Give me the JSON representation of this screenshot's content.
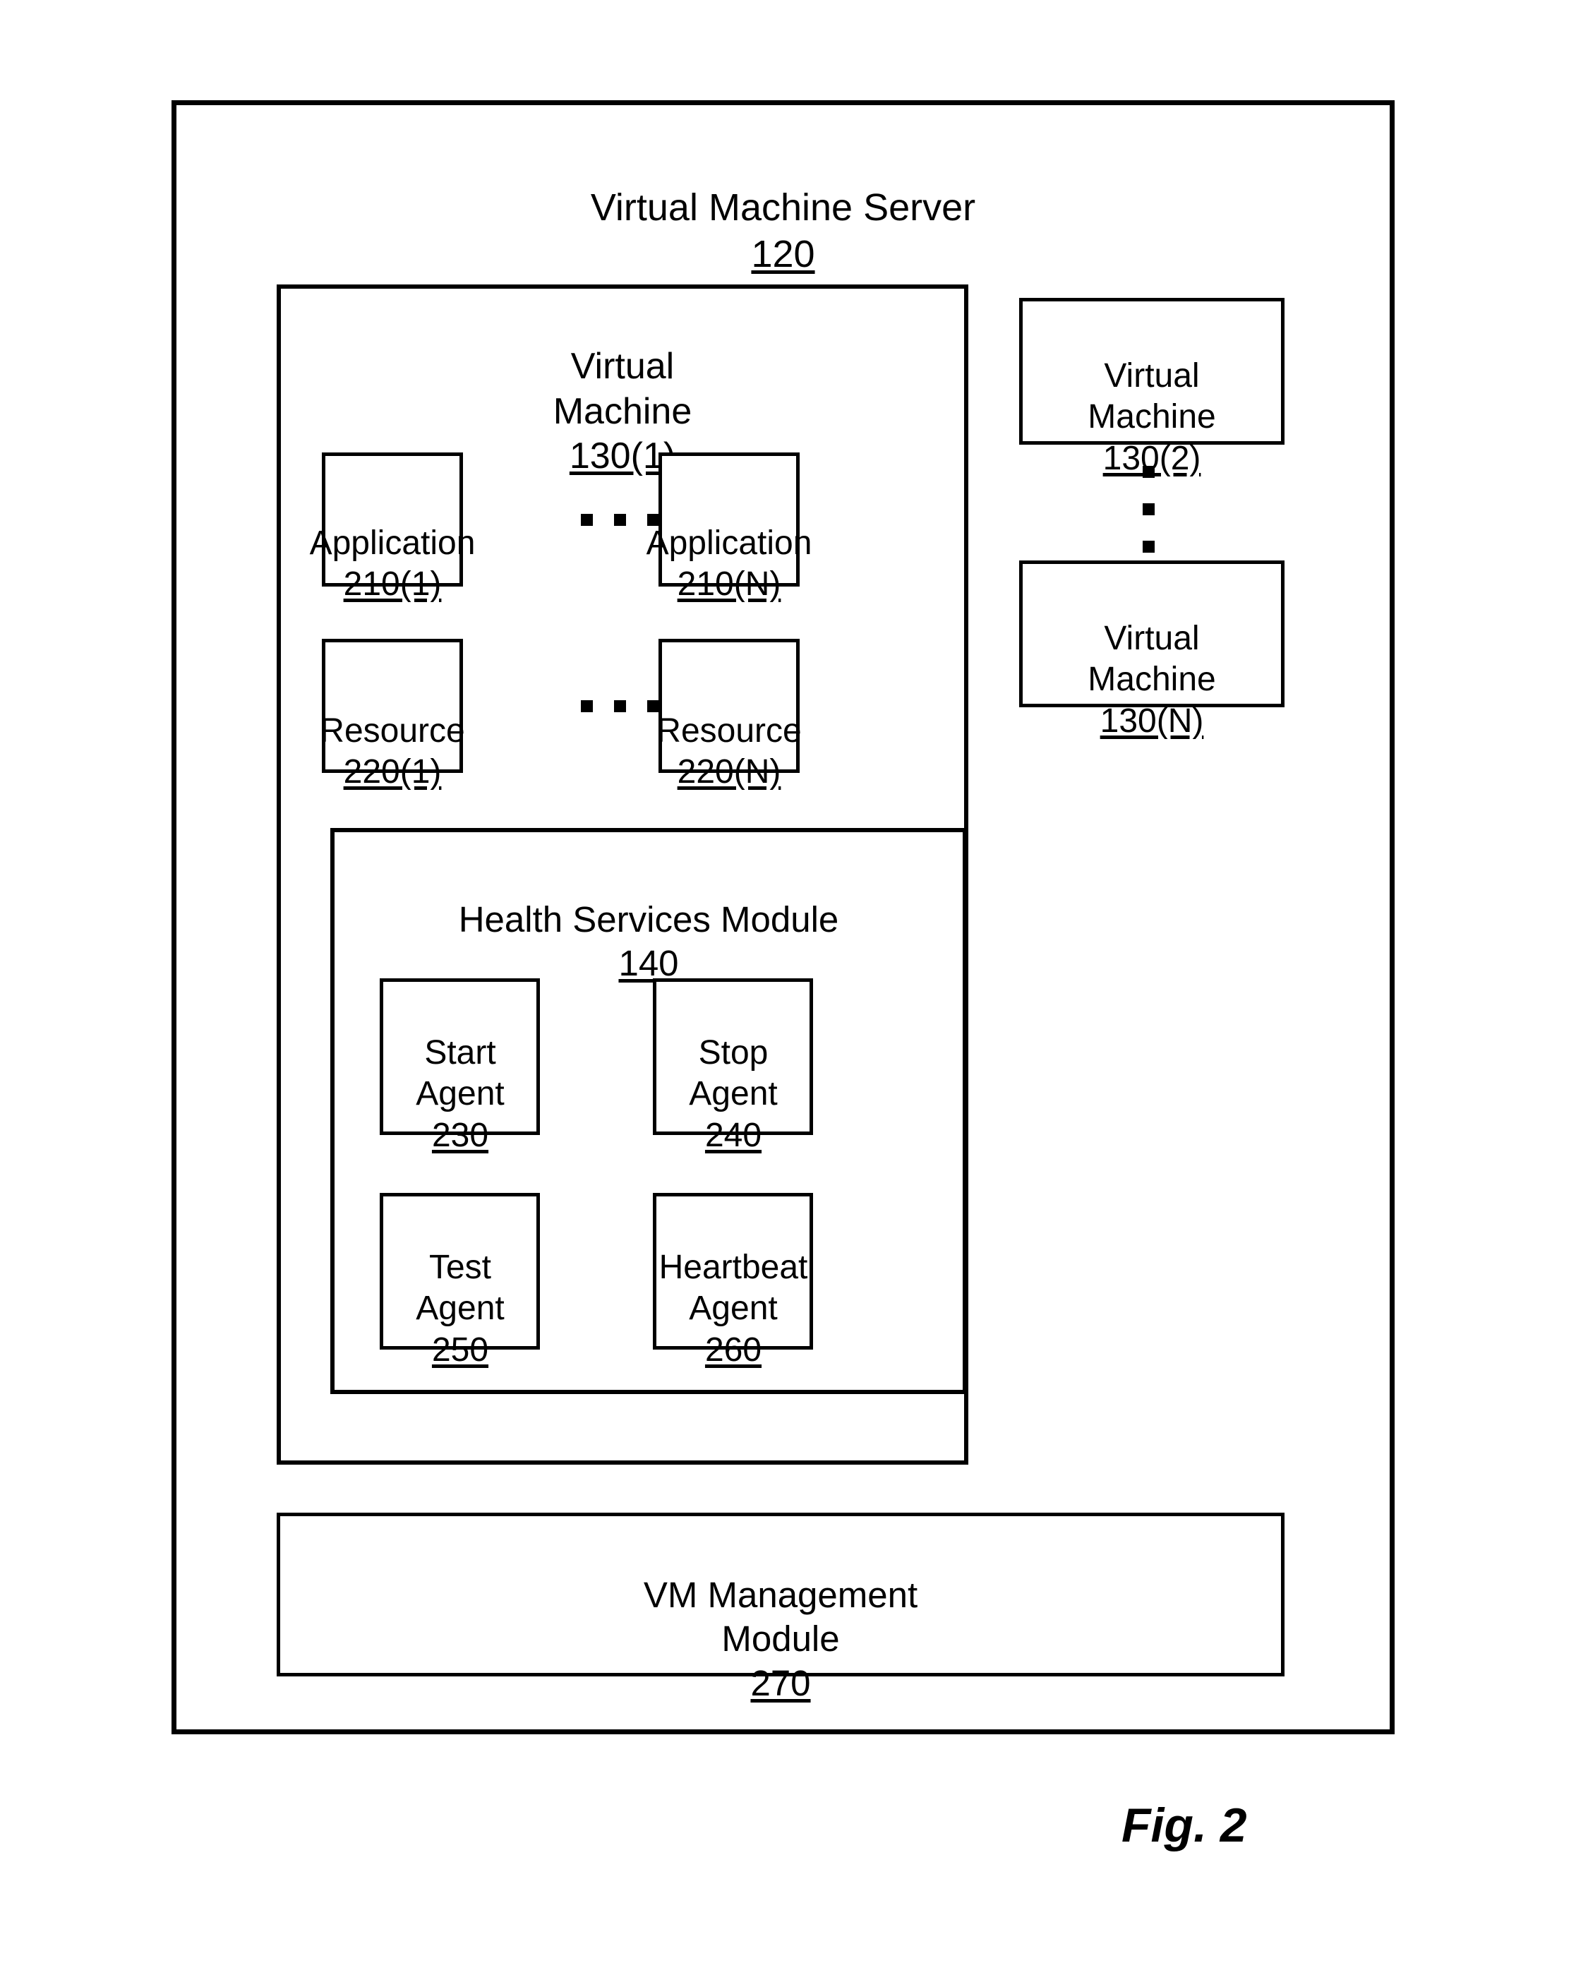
{
  "figure": {
    "caption": "Fig. 2",
    "type": "patent-block-diagram"
  },
  "server": {
    "title": "Virtual Machine Server",
    "ref": "120"
  },
  "virtual_machine_primary": {
    "title": "Virtual\nMachine",
    "ref": "130(1)",
    "applications": [
      {
        "title": "Application",
        "ref": "210(1)"
      },
      {
        "title": "Application",
        "ref": "210(N)"
      }
    ],
    "applications_ellipsis": "...",
    "resources": [
      {
        "title": "Resource",
        "ref": "220(1)"
      },
      {
        "title": "Resource",
        "ref": "220(N)"
      }
    ],
    "resources_ellipsis": "...",
    "health_services_module": {
      "title": "Health Services Module",
      "ref": "140",
      "agents": [
        {
          "title": "Start\nAgent",
          "ref": "230"
        },
        {
          "title": "Stop\nAgent",
          "ref": "240"
        },
        {
          "title": "Test\nAgent",
          "ref": "250"
        },
        {
          "title": "Heartbeat\nAgent",
          "ref": "260"
        }
      ]
    }
  },
  "virtual_machines_other": [
    {
      "title": "Virtual\nMachine",
      "ref": "130(2)"
    },
    {
      "title": "Virtual\nMachine",
      "ref": "130(N)"
    }
  ],
  "virtual_machines_ellipsis": "⋮",
  "vm_management_module": {
    "title": "VM Management\nModule",
    "ref": "270"
  },
  "colors": {
    "stroke": "#000000",
    "background": "#ffffff",
    "text": "#000000"
  }
}
